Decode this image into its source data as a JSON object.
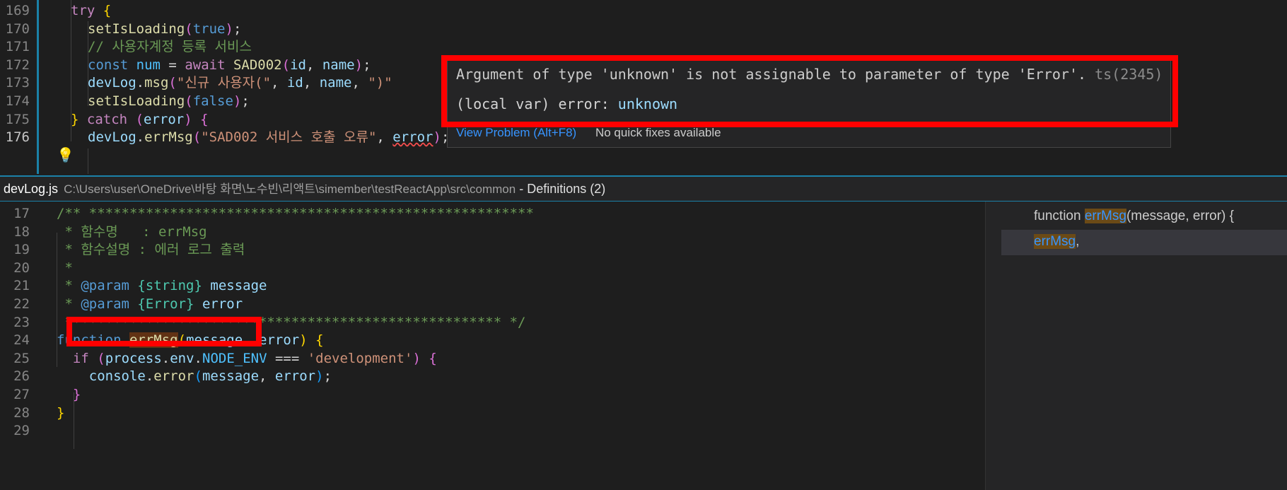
{
  "top_editor": {
    "lines": [
      {
        "num": "169",
        "tokens": [
          [
            "kw",
            "try"
          ],
          [
            "pl",
            " "
          ],
          [
            "br1",
            "{"
          ]
        ]
      },
      {
        "num": "170",
        "tokens": [
          [
            "fn",
            "setIsLoading"
          ],
          [
            "br2",
            "("
          ],
          [
            "kb",
            "true"
          ],
          [
            "br2",
            ")"
          ],
          [
            "pl",
            ";"
          ]
        ]
      },
      {
        "num": "171",
        "tokens": [
          [
            "cm",
            "// 사용자계정 등록 서비스"
          ]
        ]
      },
      {
        "num": "172",
        "tokens": [
          [
            "kb",
            "const"
          ],
          [
            "pl",
            " "
          ],
          [
            "cn",
            "num"
          ],
          [
            "pl",
            " = "
          ],
          [
            "kw",
            "await"
          ],
          [
            "pl",
            " "
          ],
          [
            "fn",
            "SAD002"
          ],
          [
            "br2",
            "("
          ],
          [
            "vr",
            "id"
          ],
          [
            "pl",
            ", "
          ],
          [
            "vr",
            "name"
          ],
          [
            "br2",
            ")"
          ],
          [
            "pl",
            ";"
          ]
        ]
      },
      {
        "num": "173",
        "tokens": [
          [
            "vr",
            "devLog"
          ],
          [
            "pl",
            "."
          ],
          [
            "fn",
            "msg"
          ],
          [
            "br2",
            "("
          ],
          [
            "st",
            "\"신규 사용자(\""
          ],
          [
            "pl",
            ", "
          ],
          [
            "vr",
            "id"
          ],
          [
            "pl",
            ", "
          ],
          [
            "vr",
            "name"
          ],
          [
            "pl",
            ", "
          ],
          [
            "st",
            "\")\""
          ]
        ]
      },
      {
        "num": "174",
        "tokens": [
          [
            "fn",
            "setIsLoading"
          ],
          [
            "br2",
            "("
          ],
          [
            "kb",
            "false"
          ],
          [
            "br2",
            ")"
          ],
          [
            "pl",
            ";"
          ]
        ]
      },
      {
        "num": "175",
        "tokens": [
          [
            "br1",
            "}"
          ],
          [
            "pl",
            " "
          ],
          [
            "kw",
            "catch"
          ],
          [
            "pl",
            " "
          ],
          [
            "br2",
            "("
          ],
          [
            "vr",
            "error"
          ],
          [
            "br2",
            ")"
          ],
          [
            "pl",
            " "
          ],
          [
            "br2",
            "{"
          ]
        ]
      },
      {
        "num": "176",
        "tokens": [
          [
            "vr",
            "devLog"
          ],
          [
            "pl",
            "."
          ],
          [
            "fn",
            "errMsg"
          ],
          [
            "br2",
            "("
          ],
          [
            "st",
            "\"SAD002 서비스 호출 오류\""
          ],
          [
            "pl",
            ", "
          ],
          [
            "vr",
            "error"
          ],
          [
            "br2",
            ")"
          ],
          [
            "pl",
            ";"
          ]
        ]
      }
    ]
  },
  "hover": {
    "message": "Argument of type 'unknown' is not assignable to parameter of type 'Error'.",
    "code": "ts(2345)",
    "signature_prefix": "(local var) error: ",
    "signature_type": "unknown",
    "view_problem": "View Problem (Alt+F8)",
    "no_fixes": "No quick fixes available"
  },
  "peek": {
    "file_name": "devLog.js",
    "path": "C:\\Users\\user\\OneDrive\\바탕 화면\\노수빈\\리액트\\simember\\testReactApp\\src\\common",
    "definitions": "- Definitions (2)",
    "lines": [
      {
        "num": "17",
        "tokens": [
          [
            "cm",
            "/** *******************************************************"
          ]
        ]
      },
      {
        "num": "18",
        "tokens": [
          [
            "cm",
            " * 함수명   : errMsg"
          ]
        ]
      },
      {
        "num": "19",
        "tokens": [
          [
            "cm",
            " * 함수설명 : 에러 로그 출력"
          ]
        ]
      },
      {
        "num": "20",
        "tokens": [
          [
            "cm",
            " *"
          ]
        ]
      },
      {
        "num": "21",
        "tokens": [
          [
            "cm",
            " * "
          ],
          [
            "kb",
            "@param"
          ],
          [
            "pl",
            " "
          ],
          [
            "ty",
            "{string}"
          ],
          [
            "pl",
            " "
          ],
          [
            "vr",
            "message"
          ]
        ]
      },
      {
        "num": "22",
        "tokens": [
          [
            "cm",
            " * "
          ],
          [
            "kb",
            "@param"
          ],
          [
            "pl",
            " "
          ],
          [
            "ty",
            "{Error}"
          ],
          [
            "pl",
            " "
          ],
          [
            "vr",
            "error"
          ]
        ]
      },
      {
        "num": "23",
        "tokens": [
          [
            "cm",
            " ****************************************************** */"
          ]
        ]
      },
      {
        "num": "24",
        "tokens": [
          [
            "kb",
            "function"
          ],
          [
            "pl",
            " "
          ],
          [
            "fn",
            "errMsg"
          ],
          [
            "br1",
            "("
          ],
          [
            "vr",
            "message"
          ],
          [
            "pl",
            ", "
          ],
          [
            "vr",
            "error"
          ],
          [
            "br1",
            ")"
          ],
          [
            "pl",
            " "
          ],
          [
            "br1",
            "{"
          ]
        ]
      },
      {
        "num": "25",
        "tokens": [
          [
            "pl",
            "  "
          ],
          [
            "kw",
            "if"
          ],
          [
            "pl",
            " "
          ],
          [
            "br2",
            "("
          ],
          [
            "vr",
            "process"
          ],
          [
            "pl",
            "."
          ],
          [
            "vr",
            "env"
          ],
          [
            "pl",
            "."
          ],
          [
            "cn",
            "NODE_ENV"
          ],
          [
            "pl",
            " === "
          ],
          [
            "st",
            "'development'"
          ],
          [
            "br2",
            ")"
          ],
          [
            "pl",
            " "
          ],
          [
            "br2",
            "{"
          ]
        ]
      },
      {
        "num": "26",
        "tokens": [
          [
            "pl",
            "    "
          ],
          [
            "vr",
            "console"
          ],
          [
            "pl",
            "."
          ],
          [
            "fn",
            "error"
          ],
          [
            "br3",
            "("
          ],
          [
            "vr",
            "message"
          ],
          [
            "pl",
            ", "
          ],
          [
            "vr",
            "error"
          ],
          [
            "br3",
            ")"
          ],
          [
            "pl",
            ";"
          ]
        ]
      },
      {
        "num": "27",
        "tokens": [
          [
            "pl",
            "  "
          ],
          [
            "br2",
            "}"
          ]
        ]
      },
      {
        "num": "28",
        "tokens": [
          [
            "br1",
            "}"
          ]
        ]
      },
      {
        "num": "29",
        "tokens": []
      }
    ]
  },
  "refs": {
    "items": [
      {
        "before": "function ",
        "match": "errMsg",
        "after": "(message, error) {"
      },
      {
        "before": "",
        "match": "errMsg",
        "after": ","
      }
    ]
  }
}
